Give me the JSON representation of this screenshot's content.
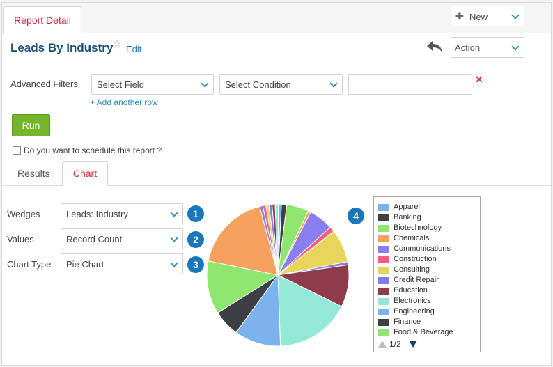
{
  "tabs": {
    "report_detail": "Report Detail"
  },
  "header": {
    "new_label": "New",
    "title": "Leads By Industry",
    "edit_label": "Edit",
    "action_label": "Action"
  },
  "filters": {
    "label": "Advanced Filters",
    "field_select": "Select Field",
    "condition_select": "Select Condition",
    "value_input": "",
    "add_row": "+ Add another row"
  },
  "run_label": "Run",
  "schedule_label": "Do you want to schedule this report ?",
  "view_tabs": {
    "results": "Results",
    "chart": "Chart"
  },
  "chart_options": {
    "wedges_label": "Wedges",
    "wedges_value": "Leads: Industry",
    "values_label": "Values",
    "values_value": "Record Count",
    "type_label": "Chart Type",
    "type_value": "Pie Chart",
    "badges": [
      "1",
      "2",
      "3",
      "4"
    ]
  },
  "legend": {
    "pager": "1/2"
  },
  "chart_data": {
    "type": "pie",
    "slices": [
      {
        "label": "Finance",
        "value": 1.2,
        "color": "#3d3f44"
      },
      {
        "label": "Food & Beverage",
        "value": 5.0,
        "color": "#8ee66f"
      },
      {
        "label": "",
        "value": 0.6,
        "color": "#f4a25d"
      },
      {
        "label": "",
        "value": 5.5,
        "color": "#8a7ff0"
      },
      {
        "label": "",
        "value": 1.2,
        "color": "#f05e80"
      },
      {
        "label": "",
        "value": 7.5,
        "color": "#e8d55b"
      },
      {
        "label": "Credit Repair",
        "value": 0.7,
        "color": "#8679e8"
      },
      {
        "label": "Education",
        "value": 9.5,
        "color": "#8e3c4c"
      },
      {
        "label": "Electronics",
        "value": 17.0,
        "color": "#93e8d8"
      },
      {
        "label": "Engineering",
        "value": 10.5,
        "color": "#7ab3ee"
      },
      {
        "label": "Banking",
        "value": 6.0,
        "color": "#3d3f44"
      },
      {
        "label": "Biotechnology",
        "value": 12.0,
        "color": "#8ee66f"
      },
      {
        "label": "Chemicals",
        "value": 17.5,
        "color": "#f4a25d"
      },
      {
        "label": "",
        "value": 0.7,
        "color": "#8a7ff0"
      },
      {
        "label": "",
        "value": 0.7,
        "color": "#f05e80"
      },
      {
        "label": "",
        "value": 0.7,
        "color": "#e8d55b"
      },
      {
        "label": "",
        "value": 0.7,
        "color": "#8679e8"
      },
      {
        "label": "",
        "value": 0.7,
        "color": "#8e3c4c"
      },
      {
        "label": "",
        "value": 0.7,
        "color": "#93e8d8"
      },
      {
        "label": "",
        "value": 0.7,
        "color": "#7ab3ee"
      }
    ],
    "legend_entries": [
      {
        "label": "Apparel",
        "color": "#7ab3ee"
      },
      {
        "label": "Banking",
        "color": "#3d3f44"
      },
      {
        "label": "Biotechnology",
        "color": "#8ee66f"
      },
      {
        "label": "Chemicals",
        "color": "#f4a25d"
      },
      {
        "label": "Communications",
        "color": "#8a7ff0"
      },
      {
        "label": "Construction",
        "color": "#f05e80"
      },
      {
        "label": "Consulting",
        "color": "#e8d55b"
      },
      {
        "label": "Credit Repair",
        "color": "#8679e8"
      },
      {
        "label": "Education",
        "color": "#8e3c4c"
      },
      {
        "label": "Electronics",
        "color": "#93e8d8"
      },
      {
        "label": "Engineering",
        "color": "#7ab3ee"
      },
      {
        "label": "Finance",
        "color": "#3d3f44"
      },
      {
        "label": "Food & Beverage",
        "color": "#8ee66f"
      }
    ],
    "legend_placement": "right"
  }
}
